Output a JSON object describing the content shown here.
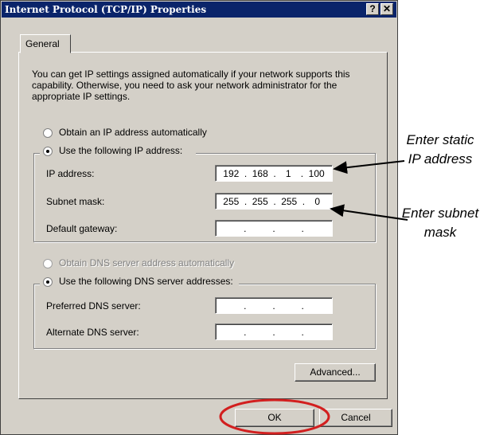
{
  "window": {
    "title": "Internet Protocol (TCP/IP) Properties",
    "help_button": "?",
    "close_button": "✕"
  },
  "tabs": [
    {
      "label": "General"
    }
  ],
  "description": "You can get IP settings assigned automatically if your network supports this capability. Otherwise, you need to ask your network administrator for the appropriate IP settings.",
  "ip": {
    "auto_label": "Obtain an IP address automatically",
    "manual_label": "Use the following IP address:",
    "selected": "manual",
    "fields": [
      {
        "label": "IP address:",
        "octets": [
          "192",
          "168",
          "1",
          "100"
        ]
      },
      {
        "label": "Subnet mask:",
        "octets": [
          "255",
          "255",
          "255",
          "0"
        ]
      },
      {
        "label": "Default gateway:",
        "octets": [
          "",
          "",
          "",
          ""
        ]
      }
    ]
  },
  "dns": {
    "auto_label": "Obtain DNS server address automatically",
    "manual_label": "Use the following DNS server addresses:",
    "selected": "manual",
    "fields": [
      {
        "label": "Preferred DNS server:",
        "octets": [
          "",
          "",
          "",
          ""
        ]
      },
      {
        "label": "Alternate DNS server:",
        "octets": [
          "",
          "",
          "",
          ""
        ]
      }
    ]
  },
  "buttons": {
    "advanced": "Advanced...",
    "ok": "OK",
    "cancel": "Cancel"
  },
  "annotations": {
    "static_ip": "Enter static IP address",
    "subnet": "Enter subnet mask"
  },
  "colors": {
    "titlebar": "#0a246a",
    "dialog": "#d4d0c8",
    "highlight_ring": "#d21f1f"
  }
}
